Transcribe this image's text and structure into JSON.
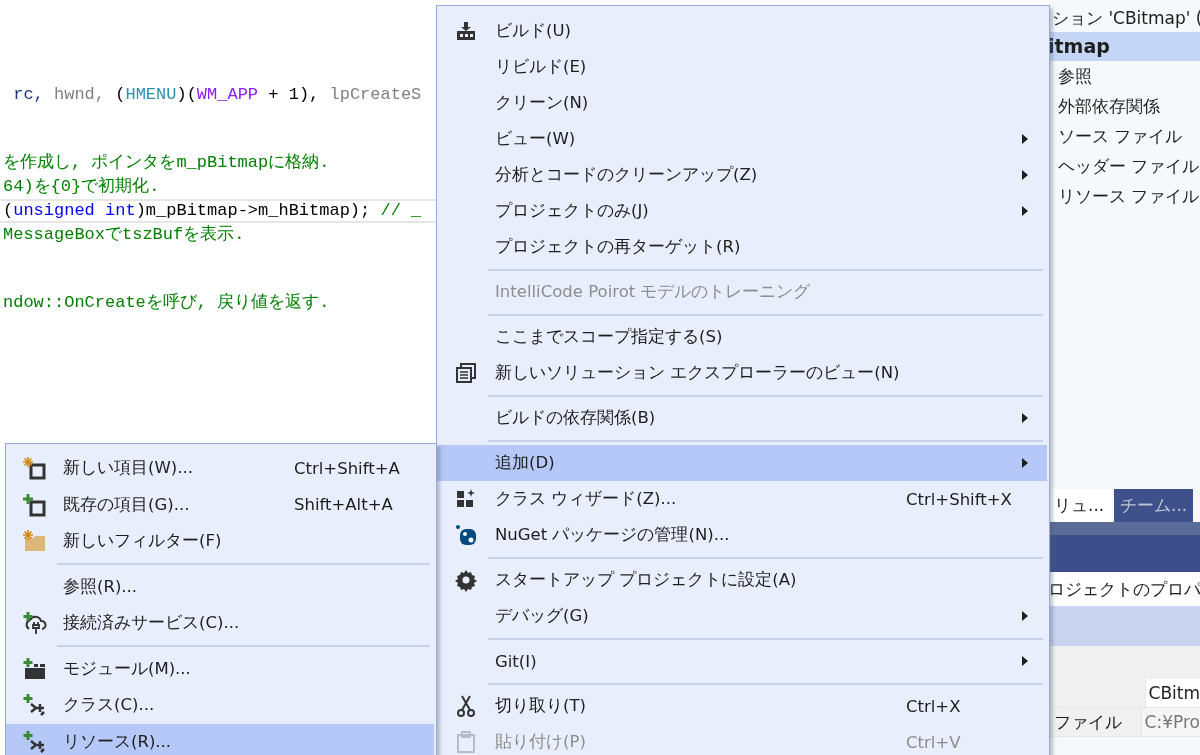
{
  "editor": {
    "blocks": [
      [
        {
          "current": false,
          "tokens": [
            {
              "kind": "local",
              "text": " rc,"
            },
            {
              "kind": "param",
              "text": " hwnd,"
            },
            {
              "kind": "plain",
              "text": " ("
            },
            {
              "kind": "type",
              "text": "HMENU"
            },
            {
              "kind": "plain",
              "text": ")("
            },
            {
              "kind": "macro",
              "text": "WM_APP"
            },
            {
              "kind": "plain",
              "text": " + 1), "
            },
            {
              "kind": "param",
              "text": "lpCreateS"
            }
          ]
        }
      ],
      [
        {
          "current": false,
          "tokens": [
            {
              "kind": "comment",
              "text": "を作成し, ポインタをm_pBitmapに格納."
            }
          ]
        },
        {
          "current": false,
          "tokens": [
            {
              "kind": "comment",
              "text": "64)を{0}で初期化."
            }
          ]
        },
        {
          "current": true,
          "tokens": [
            {
              "kind": "plain",
              "text": "("
            },
            {
              "kind": "keyword",
              "text": "unsigned int"
            },
            {
              "kind": "plain",
              "text": ")m_pBitmap->m_hBitmap); "
            },
            {
              "kind": "comment",
              "text": "// _"
            }
          ]
        },
        {
          "current": false,
          "tokens": [
            {
              "kind": "comment",
              "text": "MessageBoxでtszBufを表示."
            }
          ]
        }
      ],
      [
        {
          "current": false,
          "tokens": [
            {
              "kind": "comment",
              "text": "ndow::OnCreateを呼び, 戻り値を返す."
            }
          ]
        }
      ]
    ]
  },
  "solution_explorer": {
    "title": "ション 'CBitmap' (",
    "project": {
      "label": "itmap",
      "selected": true
    },
    "items": [
      {
        "label": "参照"
      },
      {
        "label": "外部依存関係"
      },
      {
        "label": "ソース ファイル"
      },
      {
        "label": "ヘッダー ファイル"
      },
      {
        "label": "リソース ファイル"
      }
    ],
    "tabs": [
      {
        "label": "リュ...",
        "selected": true
      },
      {
        "label": "チーム...",
        "selected": false
      }
    ]
  },
  "properties": {
    "object": "ロジェクトのプロパ",
    "rows": [
      {
        "value": "CBitm"
      },
      {
        "name": "ファイル",
        "value": "C:¥Pro"
      }
    ]
  },
  "context_menu": {
    "groups": [
      [
        {
          "kind": "build",
          "label": "ビルド(U)",
          "submenu": false,
          "disabled": false,
          "selected": false
        },
        {
          "kind": "plain",
          "label": "リビルド(E)",
          "submenu": false,
          "disabled": false,
          "selected": false
        },
        {
          "kind": "plain",
          "label": "クリーン(N)",
          "submenu": false,
          "disabled": false,
          "selected": false
        },
        {
          "kind": "plain",
          "label": "ビュー(W)",
          "submenu": true,
          "disabled": false,
          "selected": false
        },
        {
          "kind": "plain",
          "label": "分析とコードのクリーンアップ(Z)",
          "submenu": true,
          "disabled": false,
          "selected": false
        },
        {
          "kind": "plain",
          "label": "プロジェクトのみ(J)",
          "submenu": true,
          "disabled": false,
          "selected": false
        },
        {
          "kind": "plain",
          "label": "プロジェクトの再ターゲット(R)",
          "submenu": false,
          "disabled": false,
          "selected": false
        }
      ],
      [
        {
          "kind": "plain",
          "label": "IntelliCode Poirot モデルのトレーニング",
          "submenu": false,
          "disabled": true,
          "selected": false
        }
      ],
      [
        {
          "kind": "plain",
          "label": "ここまでスコープ指定する(S)",
          "submenu": false,
          "disabled": false,
          "selected": false
        },
        {
          "kind": "explorer",
          "label": "新しいソリューション エクスプローラーのビュー(N)",
          "submenu": false,
          "disabled": false,
          "selected": false
        }
      ],
      [
        {
          "kind": "plain",
          "label": "ビルドの依存関係(B)",
          "submenu": true,
          "disabled": false,
          "selected": false
        }
      ],
      [
        {
          "kind": "plain",
          "label": "追加(D)",
          "submenu": true,
          "disabled": false,
          "selected": true
        },
        {
          "kind": "wizard",
          "label": "クラス ウィザード(Z)...",
          "shortcut": "Ctrl+Shift+X",
          "submenu": false,
          "disabled": false,
          "selected": false
        },
        {
          "kind": "package",
          "label": "NuGet パッケージの管理(N)...",
          "submenu": false,
          "disabled": false,
          "selected": false
        }
      ],
      [
        {
          "kind": "gear",
          "label": "スタートアップ プロジェクトに設定(A)",
          "submenu": false,
          "disabled": false,
          "selected": false
        },
        {
          "kind": "plain",
          "label": "デバッグ(G)",
          "submenu": true,
          "disabled": false,
          "selected": false
        }
      ],
      [
        {
          "kind": "plain",
          "label": "Git(I)",
          "submenu": true,
          "disabled": false,
          "selected": false
        }
      ],
      [
        {
          "kind": "cut",
          "label": "切り取り(T)",
          "shortcut": "Ctrl+X",
          "submenu": false,
          "disabled": false,
          "selected": false
        },
        {
          "kind": "paste",
          "label": "貼り付け(P)",
          "shortcut": "Ctrl+V",
          "submenu": false,
          "disabled": true,
          "selected": false
        }
      ]
    ]
  },
  "add_submenu": {
    "groups": [
      [
        {
          "kind": "new-item",
          "label": "新しい項目(W)...",
          "shortcut": "Ctrl+Shift+A",
          "selected": false
        },
        {
          "kind": "existing-item",
          "label": "既存の項目(G)...",
          "shortcut": "Shift+Alt+A",
          "selected": false
        },
        {
          "kind": "new-folder",
          "label": "新しいフィルター(F)",
          "selected": false
        }
      ],
      [
        {
          "kind": "plain",
          "label": "参照(R)...",
          "selected": false
        },
        {
          "kind": "service",
          "label": "接続済みサービス(C)...",
          "selected": false
        }
      ],
      [
        {
          "kind": "module",
          "label": "モジュール(M)...",
          "selected": false
        },
        {
          "kind": "class",
          "label": "クラス(C)...",
          "selected": false
        },
        {
          "kind": "class",
          "label": "リソース(R)...",
          "selected": true
        }
      ]
    ]
  }
}
